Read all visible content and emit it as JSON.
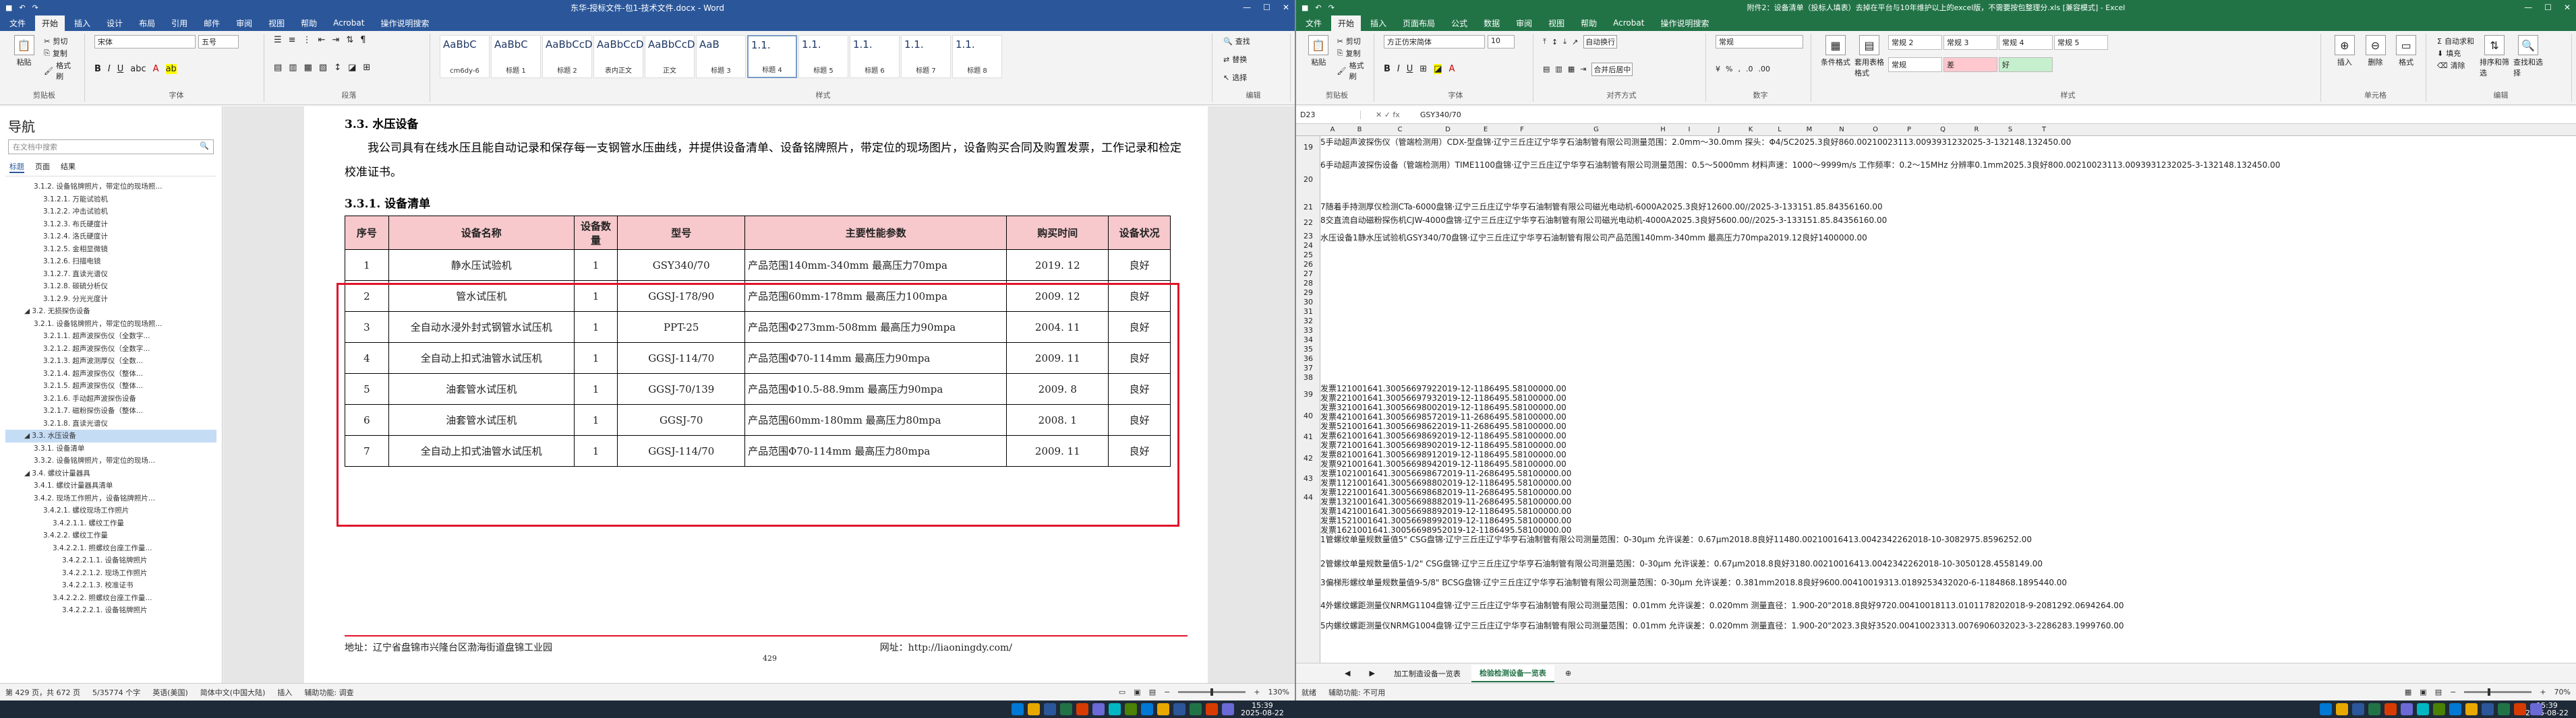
{
  "word": {
    "title": "东华-授标文件-包1-技术文件.docx  -  Word",
    "tabs": [
      "文件",
      "开始",
      "插入",
      "设计",
      "布局",
      "引用",
      "邮件",
      "审阅",
      "视图",
      "帮助",
      "Acrobat",
      "操作说明搜索"
    ],
    "clipboard": {
      "paste": "粘贴",
      "cut": "剪切",
      "copy": "复制",
      "painter": "格式刷",
      "label": "剪贴板"
    },
    "font": {
      "name": "宋体",
      "size": "五号",
      "label": "字体"
    },
    "paragraph_label": "段落",
    "styles": [
      {
        "sample": "AaBbC",
        "name": "cm6dy-6"
      },
      {
        "sample": "AaBbC",
        "name": "标题 1"
      },
      {
        "sample": "AaBbCcD",
        "name": "标题 2"
      },
      {
        "sample": "AaBbCcD",
        "name": "表内正文"
      },
      {
        "sample": "AaBbCcD",
        "name": "正文"
      },
      {
        "sample": "AaB",
        "name": "标题 3"
      },
      {
        "sample": "1.1.",
        "name": "标题 4"
      },
      {
        "sample": "1.1.",
        "name": "标题 5"
      },
      {
        "sample": "1.1.",
        "name": "标题 6"
      },
      {
        "sample": "1.1.",
        "name": "标题 7"
      },
      {
        "sample": "1.1.",
        "name": "标题 8"
      }
    ],
    "styles_label": "样式",
    "editing": {
      "find": "查找",
      "replace": "替换",
      "select": "选择",
      "label": "编辑"
    },
    "nav": {
      "title": "导航",
      "search_placeholder": "在文档中搜索",
      "tabs": [
        "标题",
        "页面",
        "结果"
      ],
      "items": [
        "3.1.2. 设备铭牌照片，带定位的现场照...",
        "3.1.2.1. 万能试验机",
        "3.1.2.2. 冲击试验机",
        "3.1.2.3. 布氏硬度计",
        "3.1.2.4. 洛氏硬度计",
        "3.1.2.5. 金相显微镜",
        "3.1.2.6. 扫描电镜",
        "3.1.2.7. 直读光谱仪",
        "3.1.2.8. 碳硫分析仪",
        "3.1.2.9. 分光光度计",
        "3.2. 无损探伤设备",
        "3.2.1. 设备铭牌照片，带定位的现场照...",
        "3.2.1.1. 超声波探伤仪（全数字...",
        "3.2.1.2. 超声波探伤仪（全数字...",
        "3.2.1.3. 超声波测厚仪（全数...",
        "3.2.1.4. 超声波探伤仪（整体...",
        "3.2.1.5. 超声波探伤仪（整体...",
        "3.2.1.6. 手动超声波探伤设备",
        "3.2.1.7. 磁粉探伤设备（整体...",
        "3.2.1.8. 直读光谱仪",
        "3.3. 水压设备",
        "3.3.1. 设备清单",
        "3.3.2. 设备铭牌照片，带定位的现场...",
        "3.4. 螺纹计量器具",
        "3.4.1. 螺纹计量器具清单",
        "3.4.2. 现场工作照片，设备铭牌照片...",
        "3.4.2.1. 螺纹现场工作照片",
        "3.4.2.1.1. 螺纹工作量",
        "3.4.2.2. 螺纹工作量",
        "3.4.2.2.1. 照螺纹台座工作量...",
        "3.4.2.2.1.1. 设备铭牌照片",
        "3.4.2.2.1.2. 现场工作照片",
        "3.4.2.2.1.3. 校准证书",
        "3.4.2.2.2. 照螺纹台座工作量...",
        "3.4.2.2.2.1. 设备铭牌照片"
      ],
      "selected_index": 20
    },
    "doc": {
      "heading_333": "3.3. 水压设备",
      "para": "我公司具有在线水压且能自动记录和保存每一支钢管水压曲线，并提供设备清单、设备铭牌照片，带定位的现场图片，设备购买合同及购置发票，工作记录和检定校准证书。",
      "heading_3331": "3.3.1. 设备清单",
      "table": {
        "headers": [
          "序号",
          "设备名称",
          "设备数量",
          "型号",
          "主要性能参数",
          "购买时间",
          "设备状况"
        ],
        "rows": [
          [
            "1",
            "静水压试验机",
            "1",
            "GSY340/70",
            "产品范围140mm-340mm  最高压力70mpa",
            "2019. 12",
            "良好"
          ],
          [
            "2",
            "管水试压机",
            "1",
            "GGSJ-178/90",
            "产品范围60mm-178mm  最高压力100mpa",
            "2009. 12",
            "良好"
          ],
          [
            "3",
            "全自动水浸外封式钢管水试压机",
            "1",
            "PPT-25",
            "产品范围Φ273mm-508mm  最高压力90mpa",
            "2004. 11",
            "良好"
          ],
          [
            "4",
            "全自动上扣式油管水试压机",
            "1",
            "GGSJ-114/70",
            "产品范围Φ70-114mm  最高压力90mpa",
            "2009. 11",
            "良好"
          ],
          [
            "5",
            "油套管水试压机",
            "1",
            "GGSJ-70/139",
            "产品范围Φ10.5-88.9mm  最高压力90mpa",
            "2009. 8",
            "良好"
          ],
          [
            "6",
            "油套管水试压机",
            "1",
            "GGSJ-70",
            "产品范围60mm-180mm  最高压力80mpa",
            "2008. 1",
            "良好"
          ],
          [
            "7",
            "全自动上扣式油管水试压机",
            "1",
            "GGSJ-114/70",
            "产品范围Φ70-114mm  最高压力80mpa",
            "2009. 11",
            "良好"
          ]
        ]
      },
      "footer_address": "地址：辽宁省盘锦市兴隆台区渤海街道盘锦工业园",
      "footer_web": "网址：http://liaoningdy.com/",
      "footer_page": "429"
    },
    "status": {
      "page": "第 429 页，共 672 页",
      "words": "5/35774 个字",
      "lang": "英语(美国)",
      "mode": "简体中文(中国大陆)",
      "insert": "插入",
      "accessibility": "辅助功能: 调查",
      "zoom": "130%"
    }
  },
  "excel": {
    "title": "附件2：设备清单（投标人填表）去掉在平台与10年维护以上的excel版，不需要按包整理分.xls [兼容模式]  -  Excel",
    "tabs": [
      "文件",
      "开始",
      "插入",
      "页面布局",
      "公式",
      "数据",
      "审阅",
      "视图",
      "帮助",
      "Acrobat",
      "操作说明搜索"
    ],
    "font": {
      "name": "方正仿宋简体",
      "size": "10",
      "label": "字体"
    },
    "align_label": "对齐方式",
    "wrap": "自动换行",
    "merge": "合并后居中",
    "number": {
      "format": "常规",
      "label": "数字"
    },
    "cond_format": "条件格式",
    "table_format": "套用表格格式",
    "cell_styles": [
      {
        "name": "常规 2",
        "bg": "#ffffff"
      },
      {
        "name": "常规 3",
        "bg": "#ffffff"
      },
      {
        "name": "常规 4",
        "bg": "#ffffff"
      },
      {
        "name": "常规 5",
        "bg": "#ffffff"
      },
      {
        "name": "常规",
        "bg": "#ffffff"
      },
      {
        "name": "差",
        "bg": "#ffc7ce"
      },
      {
        "name": "好",
        "bg": "#c6efce"
      }
    ],
    "styles_label": "样式",
    "cells_group": {
      "insert": "插入",
      "delete": "删除",
      "format": "格式",
      "label": "单元格"
    },
    "edit_group": {
      "sum": "自动求和",
      "fill": "填充",
      "clear": "清除",
      "sort": "排序和筛选",
      "find": "查找和选择",
      "label": "编辑"
    },
    "name_box": "D23",
    "formula": "GSY340/70",
    "columns": [
      "A",
      "B",
      "C",
      "D",
      "E",
      "F",
      "G",
      "H",
      "I",
      "J",
      "K",
      "L",
      "M",
      "N",
      "O",
      "P",
      "Q",
      "R",
      "S",
      "T"
    ],
    "row_numbers": [
      "19",
      "20",
      "21",
      "22",
      "23",
      "24",
      "25",
      "26",
      "27",
      "28",
      "29",
      "30",
      "31",
      "32",
      "33",
      "34",
      "35",
      "36",
      "37",
      "38",
      "39",
      "40",
      "41",
      "42",
      "43",
      "44"
    ],
    "rows": [
      {
        "c": "5",
        "d": "手动超声波探伤仪（管端检测用）",
        "e": "CDX-型",
        "f": "盘锦·辽宁三丘庄",
        "g": "辽宁华亨石油制管有限公司",
        "h": "测量范围：2.0mm～30.0mm 探头：Φ4/5C",
        "i": "2025.3",
        "j": "良好",
        "k": "860.00",
        "l": "210023113.0",
        "m": "09393123",
        "n": "2025-3-13",
        "o": "2148.13",
        "p": "2450.00"
      },
      {
        "c": "6",
        "d": "手动超声波探伤设备（管端检测用）",
        "e": "TIME1100",
        "f": "盘锦·辽宁三丘庄",
        "g": "辽宁华亨石油制管有限公司",
        "h": "测量范围：0.5～5000mm 材料声速：1000～9999m/s 工作频率：0.2～15MHz 分辨率0.1mm",
        "i": "2025.3",
        "j": "良好",
        "k": "800.00",
        "l": "210023113.0",
        "m": "09393123",
        "n": "2025-3-13",
        "o": "2148.13",
        "p": "2450.00"
      },
      {
        "c": "7",
        "d": "随着手持测厚仪检测",
        "e": "CTa-6000",
        "f": "盘锦·辽宁三丘庄",
        "g": "辽宁华亨石油制管有限公司",
        "h": "磁光电动机-6000A",
        "i": "2025.3",
        "j": "良好",
        "k": "12600.00",
        "l": "/",
        "m": "/",
        "n": "2025-3-13",
        "o": "3151.85.84",
        "p": "356160.00"
      },
      {
        "c": "8",
        "d": "交直流自动磁粉探伤机",
        "e": "CJW-4000",
        "f": "盘锦·辽宁三丘庄",
        "g": "辽宁华亨石油制管有限公司",
        "h": "磁光电动机-4000A",
        "i": "2025.3",
        "j": "良好",
        "k": "5600.00",
        "l": "/",
        "m": "/",
        "n": "2025-3-13",
        "o": "3151.85.84",
        "p": "356160.00"
      },
      {
        "a": "水压设备",
        "c": "1",
        "d": "静水压试验机",
        "e": "GSY340/70",
        "f": "盘锦·辽宁三丘庄",
        "g": "辽宁华亨石油制管有限公司",
        "h": "产品范围140mm-340mm 最高压力70mpa",
        "i": "2019.12",
        "j": "良好",
        "k": "1400000.00",
        "l": "发票1-16",
        "m": "210016413.0",
        "n": "2019-12-11",
        "o": "86495.58",
        "p": "100000.00"
      },
      {
        "c": "1",
        "d": "管螺纹单量规数量值",
        "e": "5\" CSG",
        "f": "盘锦·辽宁三丘庄",
        "g": "辽宁华亨石油制管有限公司",
        "h": "测量范围：0-30μm 允许误差：0.67μm",
        "i": "2018.8",
        "j": "良好",
        "k": "11480.00",
        "l": "210016413.0",
        "m": "04234226",
        "n": "2018-10-30",
        "o": "82975.85",
        "p": "96252.00"
      },
      {
        "c": "2",
        "d": "管螺纹单量规数量值",
        "e": "5-1/2\" CSG",
        "f": "盘锦·辽宁三丘庄",
        "g": "辽宁华亨石油制管有限公司",
        "h": "测量范围：0-30μm 允许误差：0.67μm",
        "i": "2018.8",
        "j": "良好",
        "k": "3180.00",
        "l": "210016413.0",
        "m": "04234226",
        "n": "2018-10-30",
        "o": "50128.45",
        "p": "58149.00"
      },
      {
        "c": "3",
        "d": "偏梯形螺纹单量规数量值",
        "e": "9-5/8\" BCSG",
        "f": "盘锦·辽宁三丘庄",
        "g": "辽宁华亨石油制管有限公司",
        "h": "测量范围：0-30μm 允许误差：0.381mm",
        "i": "2018.8",
        "j": "良好",
        "k": "9600.00",
        "l": "410019313.0",
        "m": "18925343",
        "n": "2020-6-11",
        "o": "84868.18",
        "p": "95440.00"
      },
      {
        "c": "4",
        "d": "外螺纹螺距测量仪",
        "e": "NRMG1104",
        "f": "盘锦·辽宁三丘庄",
        "g": "辽宁华亨石油制管有限公司",
        "h": "测量范围：0.01mm 允许误差：0.020mm 测量直径：1.900-20\"",
        "i": "2018.8",
        "j": "良好",
        "k": "9720.00",
        "l": "410018113.0",
        "m": "10117820",
        "n": "2018-9-20",
        "o": "81292.06",
        "p": "94264.00"
      },
      {
        "c": "5",
        "d": "内螺纹螺距测量仪",
        "e": "NRMG1004",
        "f": "盘锦·辽宁三丘庄",
        "g": "辽宁华亨石油制管有限公司",
        "h": "测量范围：0.01mm 允许误差：0.020mm 测量直径：1.900-20\"",
        "i": "2023.3",
        "j": "良好",
        "k": "3520.00",
        "l": "410023313.0",
        "m": "07690603",
        "n": "2023-3-22",
        "o": "86283.19",
        "p": "99760.00"
      }
    ],
    "invoice_rows": [
      {
        "l": "发票1",
        "m": "21001641.30",
        "n": "05669792",
        "o": "2019-12-11",
        "p": "86495.58",
        "q": "100000.00"
      },
      {
        "l": "发票2",
        "m": "21001641.30",
        "n": "05669793",
        "o": "2019-12-11",
        "p": "86495.58",
        "q": "100000.00"
      },
      {
        "l": "发票3",
        "m": "21001641.30",
        "n": "05669800",
        "o": "2019-12-11",
        "p": "86495.58",
        "q": "100000.00"
      },
      {
        "l": "发票4",
        "m": "21001641.30",
        "n": "05669857",
        "o": "2019-11-26",
        "p": "86495.58",
        "q": "100000.00"
      },
      {
        "l": "发票5",
        "m": "21001641.30",
        "n": "05669862",
        "o": "2019-11-26",
        "p": "86495.58",
        "q": "100000.00"
      },
      {
        "l": "发票6",
        "m": "21001641.30",
        "n": "05669869",
        "o": "2019-12-11",
        "p": "86495.58",
        "q": "100000.00"
      },
      {
        "l": "发票7",
        "m": "21001641.30",
        "n": "05669890",
        "o": "2019-12-11",
        "p": "86495.58",
        "q": "100000.00"
      },
      {
        "l": "发票8",
        "m": "21001641.30",
        "n": "05669891",
        "o": "2019-12-11",
        "p": "86495.58",
        "q": "100000.00"
      },
      {
        "l": "发票9",
        "m": "21001641.30",
        "n": "05669894",
        "o": "2019-12-11",
        "p": "86495.58",
        "q": "100000.00"
      },
      {
        "l": "发票10",
        "m": "21001641.30",
        "n": "05669867",
        "o": "2019-11-26",
        "p": "86495.58",
        "q": "100000.00"
      },
      {
        "l": "发票11",
        "m": "21001641.30",
        "n": "05669880",
        "o": "2019-12-11",
        "p": "86495.58",
        "q": "100000.00"
      },
      {
        "l": "发票12",
        "m": "21001641.30",
        "n": "05669868",
        "o": "2019-11-26",
        "p": "86495.58",
        "q": "100000.00"
      },
      {
        "l": "发票13",
        "m": "21001641.30",
        "n": "05669888",
        "o": "2019-11-26",
        "p": "86495.58",
        "q": "100000.00"
      },
      {
        "l": "发票14",
        "m": "21001641.30",
        "n": "05669889",
        "o": "2019-12-11",
        "p": "86495.58",
        "q": "100000.00"
      },
      {
        "l": "发票15",
        "m": "21001641.30",
        "n": "05669899",
        "o": "2019-12-11",
        "p": "86495.58",
        "q": "100000.00"
      },
      {
        "l": "发票16",
        "m": "21001641.30",
        "n": "05669895",
        "o": "2019-12-11",
        "p": "86495.58",
        "q": "100000.00"
      }
    ],
    "sheets": [
      "加工制造设备一览表",
      "检验检测设备一览表"
    ],
    "sheet_selected": 1,
    "status": {
      "ready": "就绪",
      "accessibility": "辅助功能: 不可用",
      "zoom": "70%"
    }
  },
  "taskbar": {
    "time_left": "15:39",
    "date_left": "2025-08-22",
    "time_right": "15:39",
    "date_right": "2025-08-22"
  }
}
